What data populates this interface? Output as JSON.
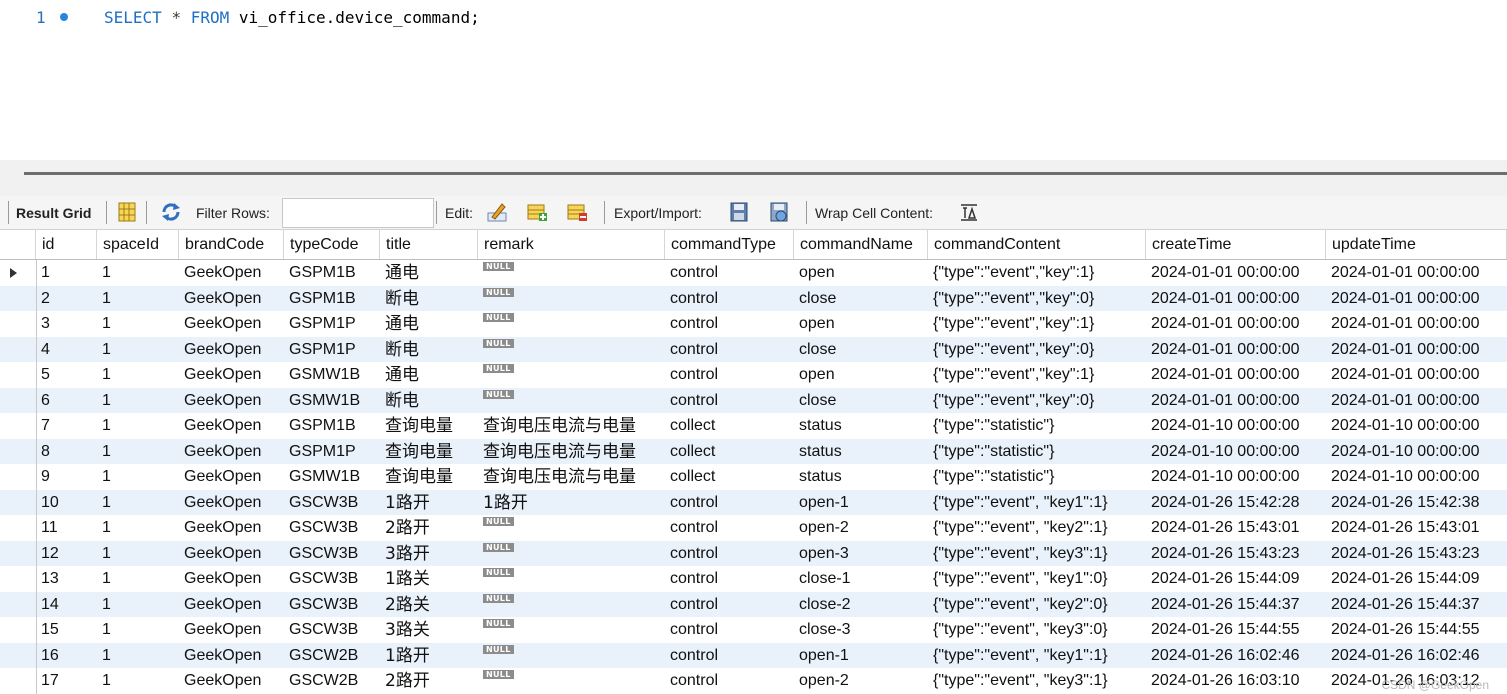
{
  "editor": {
    "line_number": "1",
    "kw_select": "SELECT",
    "star": "*",
    "kw_from": "FROM",
    "table": "vi_office.device_command;"
  },
  "toolbar": {
    "result_grid": "Result Grid",
    "filter_rows": "Filter Rows:",
    "filter_value": "",
    "edit": "Edit:",
    "export_import": "Export/Import:",
    "wrap_cell": "Wrap Cell Content:"
  },
  "grid": {
    "columns": [
      "id",
      "spaceId",
      "brandCode",
      "typeCode",
      "title",
      "remark",
      "commandType",
      "commandName",
      "commandContent",
      "createTime",
      "updateTime"
    ],
    "null_label": "NULL",
    "rows": [
      [
        "1",
        "1",
        "GeekOpen",
        "GSPM1B",
        "通电",
        null,
        "control",
        "open",
        "{\"type\":\"event\",\"key\":1}",
        "2024-01-01 00:00:00",
        "2024-01-01 00:00:00"
      ],
      [
        "2",
        "1",
        "GeekOpen",
        "GSPM1B",
        "断电",
        null,
        "control",
        "close",
        "{\"type\":\"event\",\"key\":0}",
        "2024-01-01 00:00:00",
        "2024-01-01 00:00:00"
      ],
      [
        "3",
        "1",
        "GeekOpen",
        "GSPM1P",
        "通电",
        null,
        "control",
        "open",
        "{\"type\":\"event\",\"key\":1}",
        "2024-01-01 00:00:00",
        "2024-01-01 00:00:00"
      ],
      [
        "4",
        "1",
        "GeekOpen",
        "GSPM1P",
        "断电",
        null,
        "control",
        "close",
        "{\"type\":\"event\",\"key\":0}",
        "2024-01-01 00:00:00",
        "2024-01-01 00:00:00"
      ],
      [
        "5",
        "1",
        "GeekOpen",
        "GSMW1B",
        "通电",
        null,
        "control",
        "open",
        "{\"type\":\"event\",\"key\":1}",
        "2024-01-01 00:00:00",
        "2024-01-01 00:00:00"
      ],
      [
        "6",
        "1",
        "GeekOpen",
        "GSMW1B",
        "断电",
        null,
        "control",
        "close",
        "{\"type\":\"event\",\"key\":0}",
        "2024-01-01 00:00:00",
        "2024-01-01 00:00:00"
      ],
      [
        "7",
        "1",
        "GeekOpen",
        "GSPM1B",
        "查询电量",
        "查询电压电流与电量",
        "collect",
        "status",
        "{\"type\":\"statistic\"}",
        "2024-01-10 00:00:00",
        "2024-01-10 00:00:00"
      ],
      [
        "8",
        "1",
        "GeekOpen",
        "GSPM1P",
        "查询电量",
        "查询电压电流与电量",
        "collect",
        "status",
        "{\"type\":\"statistic\"}",
        "2024-01-10 00:00:00",
        "2024-01-10 00:00:00"
      ],
      [
        "9",
        "1",
        "GeekOpen",
        "GSMW1B",
        "查询电量",
        "查询电压电流与电量",
        "collect",
        "status",
        "{\"type\":\"statistic\"}",
        "2024-01-10 00:00:00",
        "2024-01-10 00:00:00"
      ],
      [
        "10",
        "1",
        "GeekOpen",
        "GSCW3B",
        "1路开",
        "1路开",
        "control",
        "open-1",
        "{\"type\":\"event\", \"key1\":1}",
        "2024-01-26 15:42:28",
        "2024-01-26 15:42:38"
      ],
      [
        "11",
        "1",
        "GeekOpen",
        "GSCW3B",
        "2路开",
        null,
        "control",
        "open-2",
        "{\"type\":\"event\", \"key2\":1}",
        "2024-01-26 15:43:01",
        "2024-01-26 15:43:01"
      ],
      [
        "12",
        "1",
        "GeekOpen",
        "GSCW3B",
        "3路开",
        null,
        "control",
        "open-3",
        "{\"type\":\"event\", \"key3\":1}",
        "2024-01-26 15:43:23",
        "2024-01-26 15:43:23"
      ],
      [
        "13",
        "1",
        "GeekOpen",
        "GSCW3B",
        "1路关",
        null,
        "control",
        "close-1",
        "{\"type\":\"event\", \"key1\":0}",
        "2024-01-26 15:44:09",
        "2024-01-26 15:44:09"
      ],
      [
        "14",
        "1",
        "GeekOpen",
        "GSCW3B",
        "2路关",
        null,
        "control",
        "close-2",
        "{\"type\":\"event\", \"key2\":0}",
        "2024-01-26 15:44:37",
        "2024-01-26 15:44:37"
      ],
      [
        "15",
        "1",
        "GeekOpen",
        "GSCW3B",
        "3路关",
        null,
        "control",
        "close-3",
        "{\"type\":\"event\", \"key3\":0}",
        "2024-01-26 15:44:55",
        "2024-01-26 15:44:55"
      ],
      [
        "16",
        "1",
        "GeekOpen",
        "GSCW2B",
        "1路开",
        null,
        "control",
        "open-1",
        "{\"type\":\"event\", \"key1\":1}",
        "2024-01-26 16:02:46",
        "2024-01-26 16:02:46"
      ],
      [
        "17",
        "1",
        "GeekOpen",
        "GSCW2B",
        "2路开",
        null,
        "control",
        "open-2",
        "{\"type\":\"event\", \"key3\":1}",
        "2024-01-26 16:03:10",
        "2024-01-26 16:03:12"
      ]
    ]
  },
  "watermark": "CSDN @GeekOpen"
}
